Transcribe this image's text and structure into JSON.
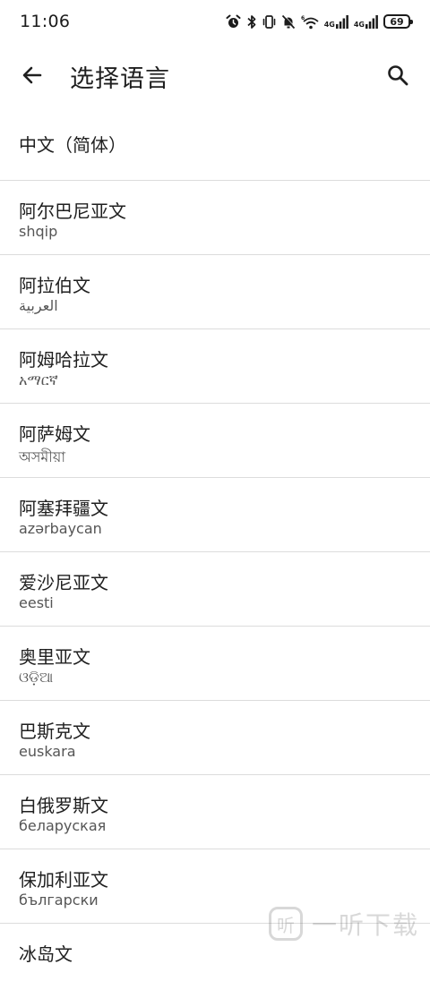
{
  "status_bar": {
    "time": "11:06",
    "net_label_1": "4G",
    "net_label_2": "4G",
    "battery": "69",
    "icons": [
      "alarm-icon",
      "bluetooth-icon",
      "vibrate-icon",
      "mute-icon",
      "wifi-icon",
      "signal-icon",
      "signal-icon",
      "battery-icon"
    ]
  },
  "app_bar": {
    "title": "选择语言",
    "back_icon": "arrow-left-icon",
    "search_icon": "search-icon"
  },
  "languages": [
    {
      "name": "中文（简体）",
      "native": ""
    },
    {
      "name": "阿尔巴尼亚文",
      "native": "shqip"
    },
    {
      "name": "阿拉伯文",
      "native": "العربية"
    },
    {
      "name": "阿姆哈拉文",
      "native": "አማርኛ"
    },
    {
      "name": "阿萨姆文",
      "native": "অসমীয়া"
    },
    {
      "name": "阿塞拜疆文",
      "native": "azərbaycan"
    },
    {
      "name": "爱沙尼亚文",
      "native": "eesti"
    },
    {
      "name": "奥里亚文",
      "native": "ଓଡ଼ିଆ"
    },
    {
      "name": "巴斯克文",
      "native": "euskara"
    },
    {
      "name": "白俄罗斯文",
      "native": "беларуская"
    },
    {
      "name": "保加利亚文",
      "native": "български"
    },
    {
      "name": "冰岛文",
      "native": ""
    }
  ],
  "watermark": {
    "badge": "听",
    "text": "一听下载"
  },
  "colors": {
    "background": "#ffffff",
    "text_primary": "#1f1f1f",
    "text_secondary": "#555555",
    "divider": "#dcdcdc"
  }
}
